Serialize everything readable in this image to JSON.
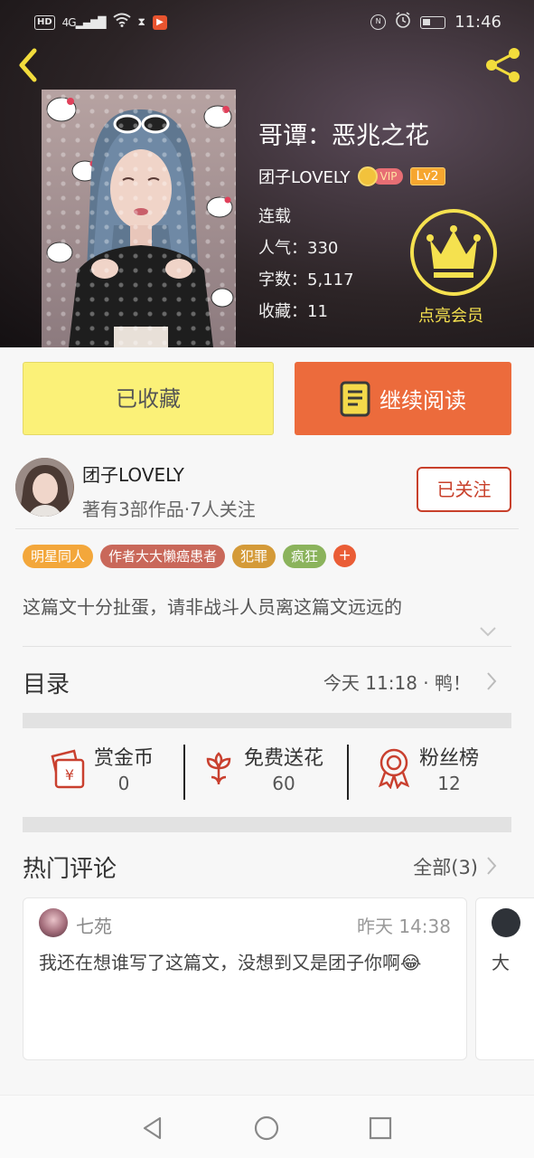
{
  "status_bar": {
    "left_icons": [
      "hd-icon",
      "signal-4g-icon",
      "wifi-icon",
      "hourglass-icon",
      "app-icon"
    ],
    "network": "4G",
    "time": "11:46",
    "right_icons": [
      "nfc-icon",
      "alarm-icon",
      "battery-icon"
    ]
  },
  "header": {
    "back_icon": "chevron-left-icon",
    "share_icon": "share-icon"
  },
  "book": {
    "title": "哥谭：恶兆之花",
    "author": "团子LOVELY",
    "vip": "VIP",
    "level": "Lv2",
    "status": "连载",
    "popularity": "人气：330",
    "word_count": "字数：5,117",
    "favorites": "收藏：11",
    "member_label": "点亮会员"
  },
  "actions": {
    "favorited_label": "已收藏",
    "continue_label": "继续阅读"
  },
  "author_block": {
    "name": "团子LOVELY",
    "subtitle": "著有3部作品·7人关注",
    "follow_label": "已关注"
  },
  "tags": [
    {
      "label": "明星同人",
      "color": "#f3a73b"
    },
    {
      "label": "作者大大懒癌患者",
      "color": "#c9685a"
    },
    {
      "label": "犯罪",
      "color": "#d49a38"
    },
    {
      "label": "疯狂",
      "color": "#8bb35c"
    }
  ],
  "tag_add": "+",
  "synopsis": "这篇文十分扯蛋，请非战斗人员离这篇文远远的",
  "catalog": {
    "label": "目录",
    "update": "今天 11:18 · 鸭！"
  },
  "stats": [
    {
      "label": "赏金币",
      "value": "0",
      "icon": "red-envelope-icon"
    },
    {
      "label": "免费送花",
      "value": "60",
      "icon": "flower-icon"
    },
    {
      "label": "粉丝榜",
      "value": "12",
      "icon": "medal-icon"
    }
  ],
  "comments": {
    "label": "热门评论",
    "all_label": "全部(3)",
    "items": [
      {
        "user": "七苑",
        "time": "昨天 14:38",
        "text": "我还在想谁写了这篇文，没想到又是团子你啊😂"
      },
      {
        "text": "大"
      }
    ]
  },
  "colors": {
    "accent_orange": "#ec6b3c",
    "favorite_yellow": "#fbf178",
    "crown_yellow": "#f5e14f",
    "follow_red": "#c8402b"
  }
}
